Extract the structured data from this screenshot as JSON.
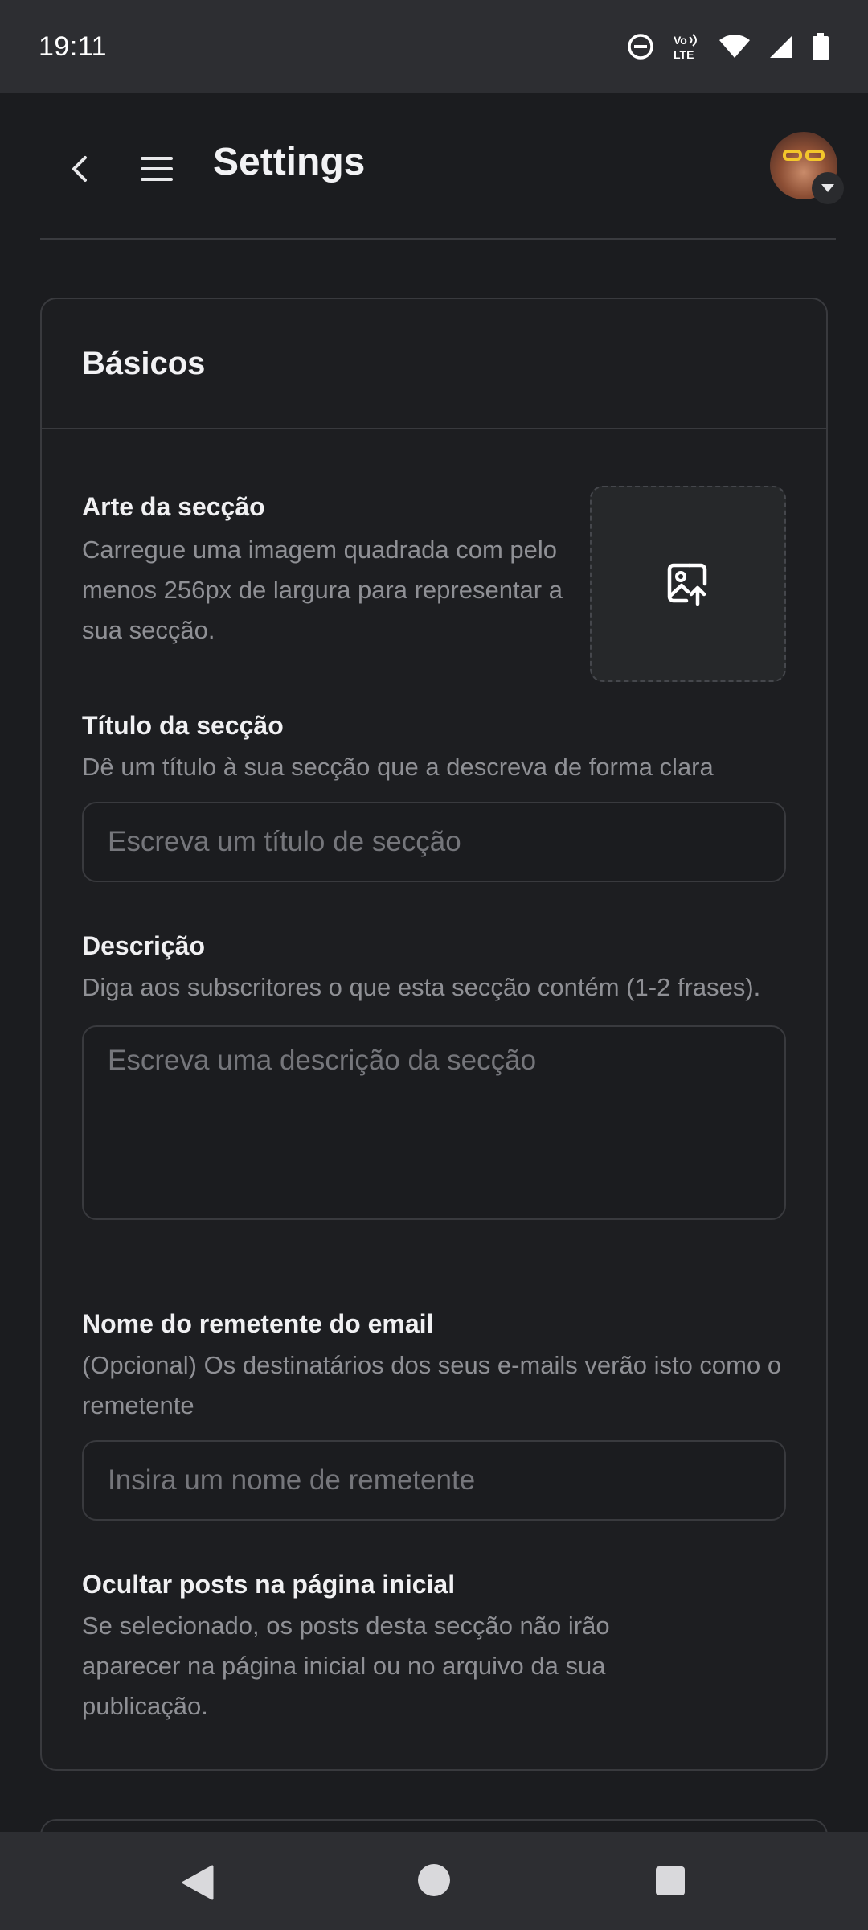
{
  "status_bar": {
    "time": "19:11",
    "icons": [
      "do-not-disturb-icon",
      "volte-icon",
      "wifi-icon",
      "signal-icon",
      "battery-icon"
    ],
    "volte_top": "Vo",
    "volte_bottom": "LTE"
  },
  "app_bar": {
    "title": "Settings",
    "back_icon": "chevron-left-icon",
    "menu_icon": "hamburger-menu-icon",
    "avatar_menu_icon": "caret-down-icon"
  },
  "card": {
    "title": "Básicos",
    "art": {
      "label": "Arte da secção",
      "help": "Carregue uma imagem quadrada com pelo menos 256px de largura para representar a sua secção.",
      "upload_icon": "image-upload-icon"
    },
    "title_field": {
      "label": "Título da secção",
      "help": "Dê um título à sua secção que a descreva de forma clara",
      "placeholder": "Escreva um título de secção",
      "value": ""
    },
    "description": {
      "label": "Descrição",
      "help": "Diga aos subscritores o que esta secção contém (1-2 frases).",
      "placeholder": "Escreva uma descrição da secção",
      "value": ""
    },
    "sender": {
      "label": "Nome do remetente do email",
      "help": "(Opcional) Os destinatários dos seus e-mails verão isto como o remetente",
      "placeholder": "Insira um nome de remetente",
      "value": ""
    },
    "hide_posts": {
      "label": "Ocultar posts na página inicial",
      "help": "Se selecionado, os posts desta secção não irão aparecer na página inicial ou no arquivo da sua publicação.",
      "checked": false
    }
  },
  "nav_bar": {
    "icons": [
      "nav-back-icon",
      "nav-home-icon",
      "nav-recents-icon"
    ]
  },
  "colors": {
    "background": "#1b1c1f",
    "card_border": "#393a3e",
    "system_bar": "#2d2e32",
    "placeholder": "#75767b",
    "help_text": "#8f9095",
    "accent_avatar_glasses": "#f3c62b"
  }
}
